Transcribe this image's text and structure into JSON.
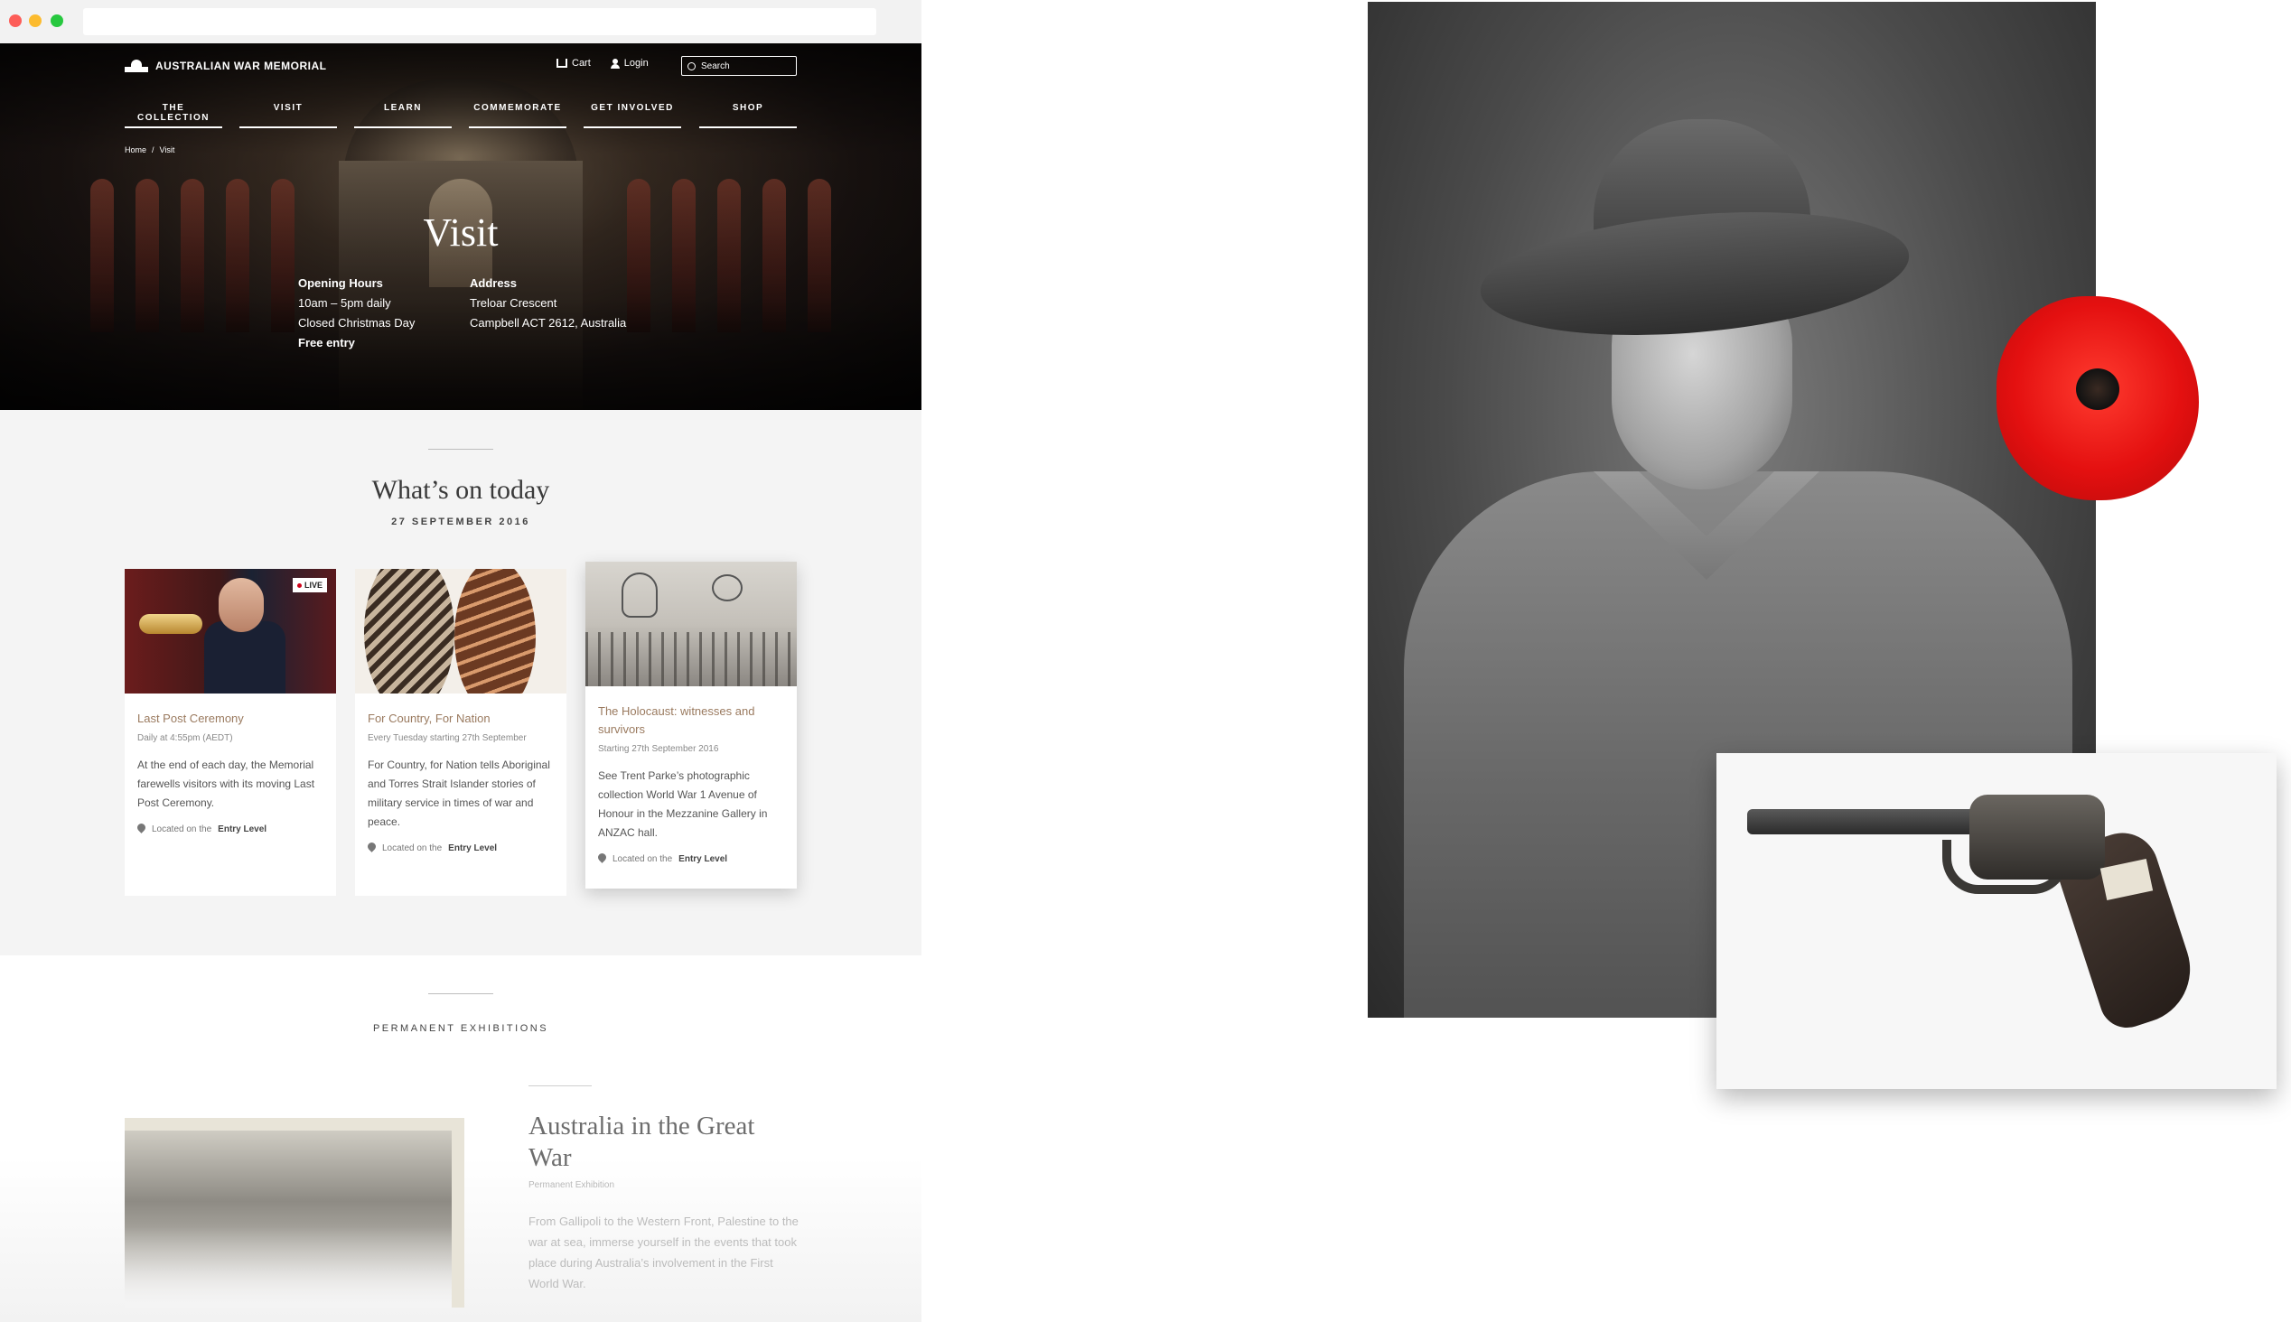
{
  "site": {
    "name": "AUSTRALIAN WAR MEMORIAL",
    "cart_label": "Cart",
    "login_label": "Login",
    "search_placeholder": "Search"
  },
  "nav": {
    "items": [
      {
        "label": "THE COLLECTION"
      },
      {
        "label": "VISIT"
      },
      {
        "label": "LEARN"
      },
      {
        "label": "COMMEMORATE"
      },
      {
        "label": "GET INVOLVED"
      },
      {
        "label": "SHOP"
      }
    ]
  },
  "breadcrumb": {
    "home": "Home",
    "separator": "/",
    "current": "Visit"
  },
  "hero": {
    "title": "Visit",
    "hours": {
      "heading": "Opening Hours",
      "line1": "10am – 5pm daily",
      "line2": "Closed Christmas Day",
      "line3": "Free entry"
    },
    "address": {
      "heading": "Address",
      "line1": "Treloar Crescent",
      "line2": "Campbell ACT 2612, Australia"
    }
  },
  "whats_on": {
    "title": "What’s on today",
    "date": "27 SEPTEMBER 2016",
    "cards": [
      {
        "badge": "LIVE",
        "title": "Last Post Ceremony",
        "sub": "Daily at 4:55pm (AEDT)",
        "desc": "At the end of each day, the Memorial farewells visitors with its moving Last Post Ceremony.",
        "loc_prefix": "Located on the",
        "loc_level": "Entry Level"
      },
      {
        "title": "For Country, For Nation",
        "sub": "Every Tuesday starting 27th September",
        "desc": "For Country, for Nation tells Aboriginal and Torres Strait Islander stories of military service in times of war and peace.",
        "loc_prefix": "Located on the",
        "loc_level": "Entry Level"
      },
      {
        "title": "The Holocaust: witnesses and survivors",
        "sub": "Starting 27th September 2016",
        "desc": "See Trent Parke’s photographic collection World War 1 Avenue of Honour in the Mezzanine Gallery in ANZAC hall.",
        "loc_prefix": "Located on the",
        "loc_level": "Entry Level"
      }
    ]
  },
  "permanent": {
    "title": "PERMANENT EXHIBITIONS",
    "exhibit": {
      "title": "Australia in the Great War",
      "sub": "Permanent Exhibition",
      "desc": "From Gallipoli to the Western Front, Palestine to the war at sea, immerse yourself in the events that took place during Australia’s involvement in the First World War."
    }
  },
  "colors": {
    "accent": "#9a7a5f",
    "hero_bg": "#1b1412",
    "poppy": "#e41010",
    "live": "#d0021b"
  }
}
